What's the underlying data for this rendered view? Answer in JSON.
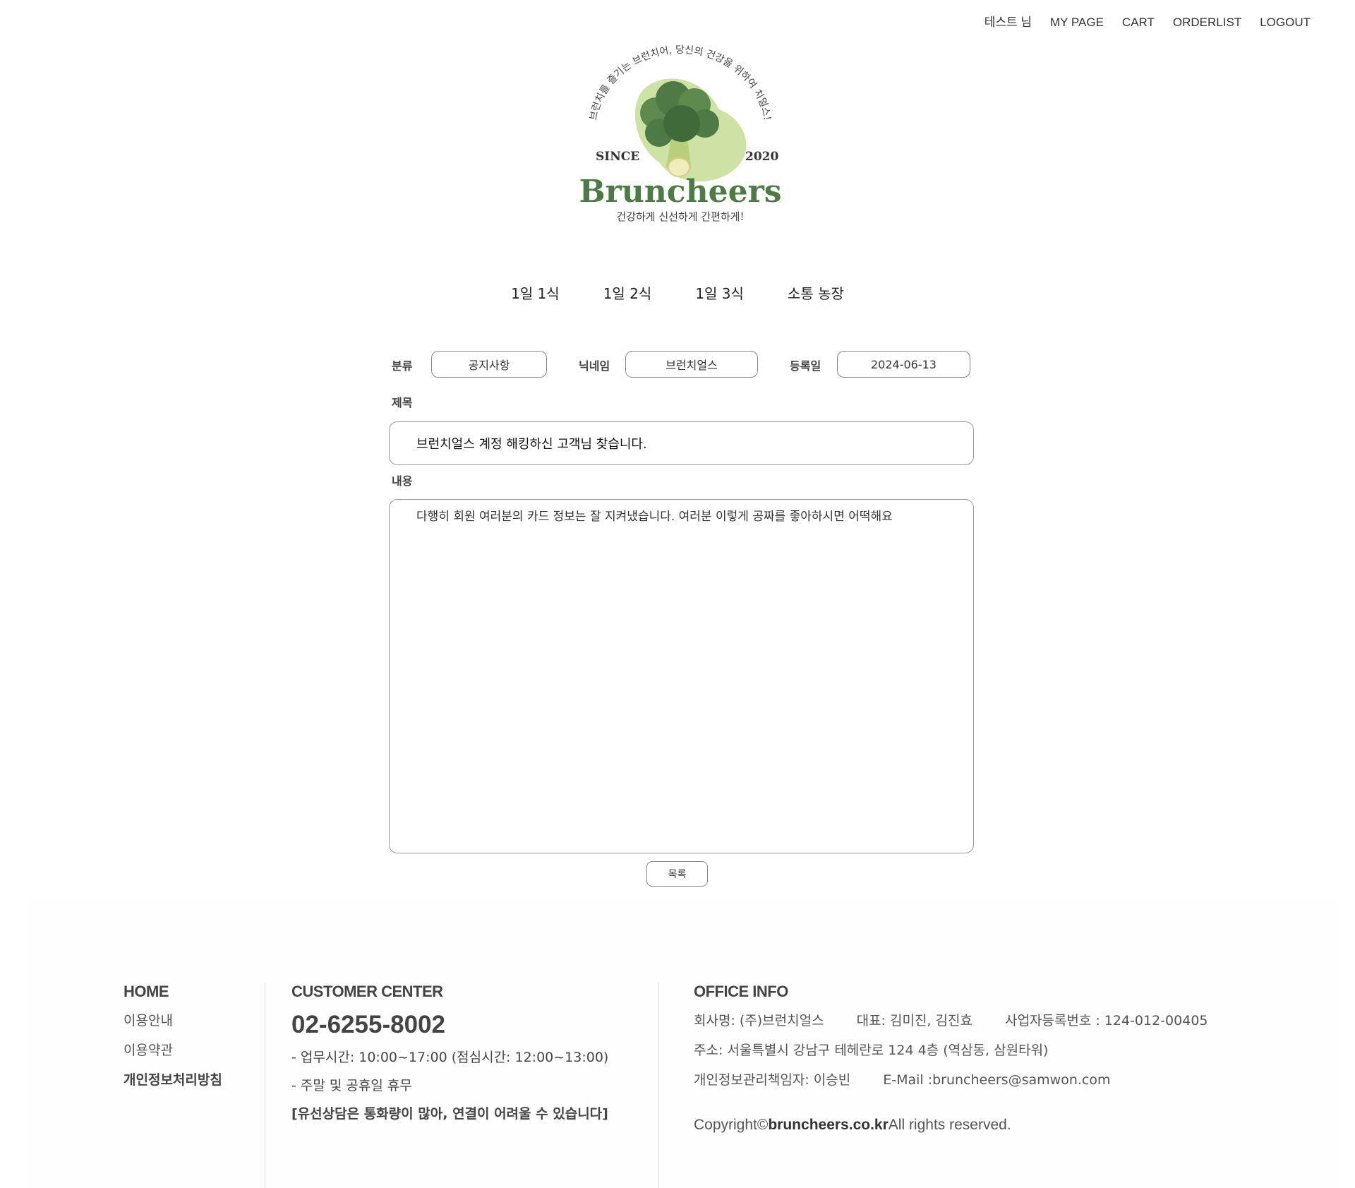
{
  "topnav": {
    "user": "테스트 님",
    "mypage": "MY PAGE",
    "cart": "CART",
    "orderlist": "ORDERLIST",
    "logout": "LOGOUT"
  },
  "logo": {
    "arc_text": "브런치를 즐기는 브런치어, 당신의 건강을 위하여 치얼스!",
    "since": "SINCE",
    "year": "2020",
    "brand": "Bruncheers",
    "tagline": "건강하게 신선하게 간편하게!",
    "colors": {
      "green_dark": "#4e7a45",
      "green_light": "#cfe2a6",
      "text": "#444444"
    }
  },
  "mainnav": {
    "items": [
      "1일 1식",
      "1일 2식",
      "1일 3식",
      "소통 농장"
    ]
  },
  "post": {
    "category_label": "분류",
    "category_value": "공지사항",
    "nickname_label": "닉네임",
    "nickname_value": "브런치얼스",
    "date_label": "등록일",
    "date_value": "2024-06-13",
    "title_label": "제목",
    "title_value": "브런치얼스 계정 해킹하신 고객님 찾습니다.",
    "content_label": "내용",
    "content_value": "다행히 회원 여러분의 카드 정보는 잘 지켜냈습니다. 여러분 이렇게 공짜를 좋아하시면 어떡해요",
    "list_button": "목록"
  },
  "footer": {
    "home": "HOME",
    "links": [
      "이용안내",
      "이용약관",
      "개인정보처리방침"
    ],
    "cs_title": "CUSTOMER CENTER",
    "phone": "02-6255-8002",
    "hours": "- 업무시간: 10:00~17:00 (점심시간: 12:00~13:00)",
    "holiday": "- 주말 및 공휴일 휴무",
    "notice": "[유선상담은 통화량이 많아, 연결이 어려울 수 있습니다]",
    "office_title": "OFFICE INFO",
    "company": "회사명: (주)브런치얼스",
    "ceo": "대표: 김미진, 김진효",
    "bizno": "사업자등록번호 : 124-012-00405",
    "address": "주소: 서울특별시 강남구 테헤란로 124 4층 (역삼동, 삼원타워)",
    "privacy_officer": "개인정보관리책임자: 이승빈",
    "email": "E-Mail :bruncheers@samwon.com",
    "copyright_pre": "Copyright©",
    "copyright_domain": "bruncheers.co.kr",
    "copyright_post": "All rights reserved."
  }
}
